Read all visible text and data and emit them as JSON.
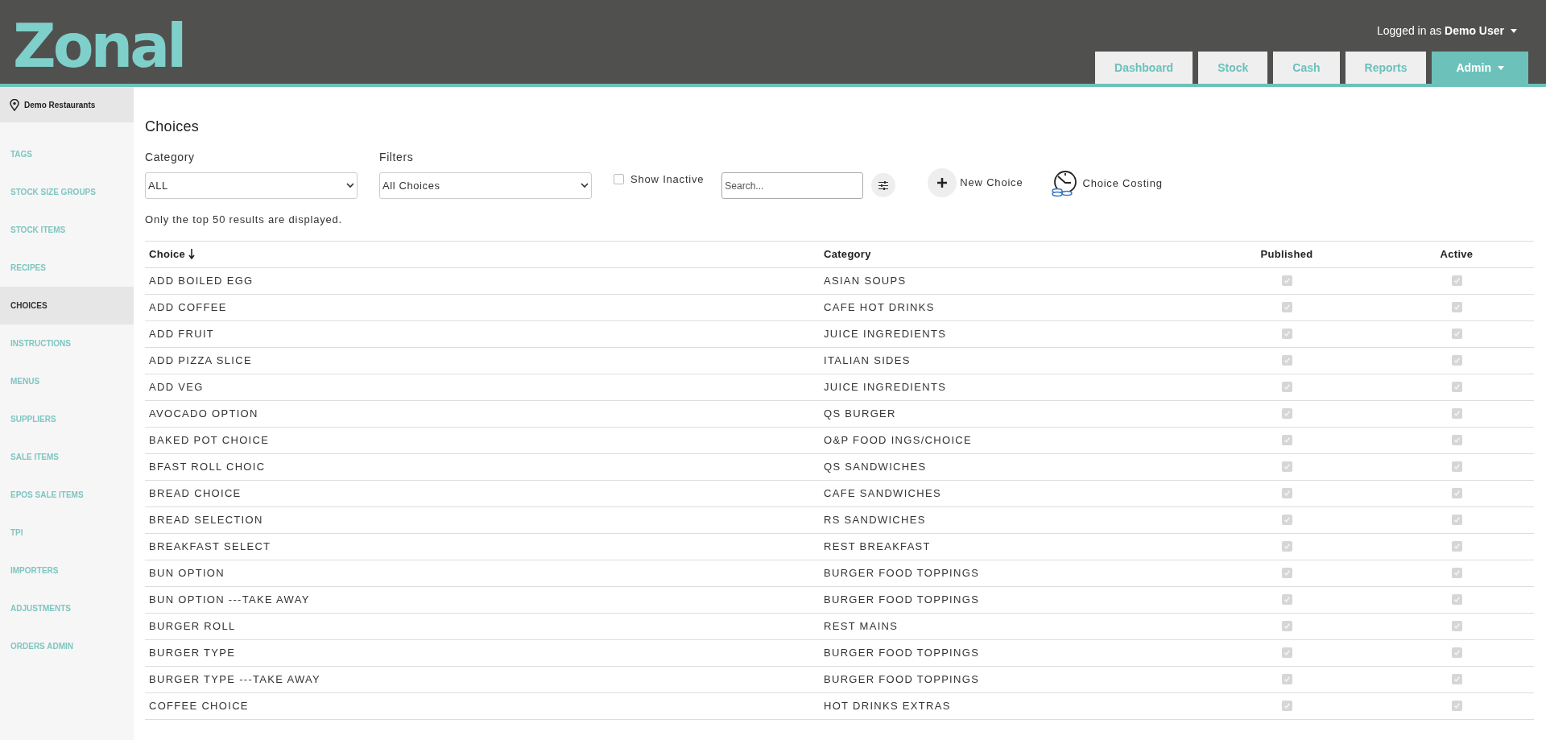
{
  "header": {
    "logo": "Zonal",
    "user": {
      "prefix": "Logged in as",
      "name": "Demo User"
    },
    "tabs": [
      {
        "label": "Dashboard",
        "selected": false,
        "dropdown": false
      },
      {
        "label": "Stock",
        "selected": false,
        "dropdown": false
      },
      {
        "label": "Cash",
        "selected": false,
        "dropdown": false
      },
      {
        "label": "Reports",
        "selected": false,
        "dropdown": false
      },
      {
        "label": "Admin",
        "selected": true,
        "dropdown": true
      }
    ]
  },
  "sidebar": {
    "location": "Demo Restaurants",
    "items": [
      {
        "label": "TAGS",
        "selected": false
      },
      {
        "label": "STOCK SIZE GROUPS",
        "selected": false
      },
      {
        "label": "STOCK ITEMS",
        "selected": false
      },
      {
        "label": "RECIPES",
        "selected": false
      },
      {
        "label": "CHOICES",
        "selected": true
      },
      {
        "label": "INSTRUCTIONS",
        "selected": false
      },
      {
        "label": "MENUS",
        "selected": false
      },
      {
        "label": "SUPPLIERS",
        "selected": false
      },
      {
        "label": "SALE ITEMS",
        "selected": false
      },
      {
        "label": "EPOS SALE ITEMS",
        "selected": false
      },
      {
        "label": "TPI",
        "selected": false
      },
      {
        "label": "IMPORTERS",
        "selected": false
      },
      {
        "label": "ADJUSTMENTS",
        "selected": false
      },
      {
        "label": "ORDERS ADMIN",
        "selected": false
      }
    ]
  },
  "page": {
    "title": "Choices",
    "category": {
      "label": "Category",
      "value": "ALL"
    },
    "filters": {
      "label": "Filters",
      "value": "All Choices"
    },
    "show_inactive": {
      "label": "Show Inactive",
      "checked": false
    },
    "search": {
      "placeholder": "Search..."
    },
    "actions": [
      {
        "kind": "new",
        "label": "New Choice"
      },
      {
        "kind": "costing",
        "label": "Choice Costing"
      }
    ],
    "notice": "Only the top 50 results are displayed.",
    "table": {
      "columns": [
        {
          "label": "Choice",
          "sorted": true
        },
        {
          "label": "Category",
          "sorted": false
        },
        {
          "label": "Published",
          "sorted": false
        },
        {
          "label": "Active",
          "sorted": false
        }
      ],
      "rows": [
        {
          "choice": "ADD BOILED EGG",
          "category": "ASIAN SOUPS",
          "published": true,
          "active": true
        },
        {
          "choice": "ADD COFFEE",
          "category": "CAFE HOT DRINKS",
          "published": true,
          "active": true
        },
        {
          "choice": "ADD FRUIT",
          "category": "JUICE INGREDIENTS",
          "published": true,
          "active": true
        },
        {
          "choice": "ADD PIZZA SLICE",
          "category": "ITALIAN SIDES",
          "published": true,
          "active": true
        },
        {
          "choice": "ADD VEG",
          "category": "JUICE INGREDIENTS",
          "published": true,
          "active": true
        },
        {
          "choice": "AVOCADO OPTION",
          "category": "QS BURGER",
          "published": true,
          "active": true
        },
        {
          "choice": "BAKED POT CHOICE",
          "category": "O&P FOOD INGS/CHOICE",
          "published": true,
          "active": true
        },
        {
          "choice": "BFAST ROLL CHOIC",
          "category": "QS SANDWICHES",
          "published": true,
          "active": true
        },
        {
          "choice": "BREAD CHOICE",
          "category": "CAFE SANDWICHES",
          "published": true,
          "active": true
        },
        {
          "choice": "BREAD SELECTION",
          "category": "RS SANDWICHES",
          "published": true,
          "active": true
        },
        {
          "choice": "BREAKFAST SELECT",
          "category": "REST BREAKFAST",
          "published": true,
          "active": true
        },
        {
          "choice": "BUN OPTION",
          "category": "BURGER FOOD TOPPINGS",
          "published": true,
          "active": true
        },
        {
          "choice": "BUN OPTION ---TAKE AWAY",
          "category": "BURGER FOOD TOPPINGS",
          "published": true,
          "active": true
        },
        {
          "choice": "BURGER ROLL",
          "category": "REST MAINS",
          "published": true,
          "active": true
        },
        {
          "choice": "BURGER TYPE",
          "category": "BURGER FOOD TOPPINGS",
          "published": true,
          "active": true
        },
        {
          "choice": "BURGER TYPE ---TAKE AWAY",
          "category": "BURGER FOOD TOPPINGS",
          "published": true,
          "active": true
        },
        {
          "choice": "COFFEE CHOICE",
          "category": "HOT DRINKS EXTRAS",
          "published": true,
          "active": true
        }
      ]
    }
  }
}
